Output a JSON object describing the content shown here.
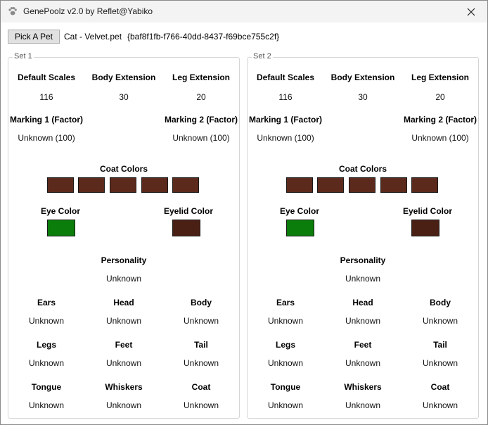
{
  "window": {
    "title": "GenePoolz v2.0 by Reflet@Yabiko"
  },
  "toolbar": {
    "pick_label": "Pick A Pet",
    "pet_name": "Cat - Velvet.pet",
    "pet_guid": "{baf8f1fb-f766-40dd-8437-f69bce755c2f}"
  },
  "labels": {
    "default_scales": "Default Scales",
    "body_extension": "Body Extension",
    "leg_extension": "Leg Extension",
    "marking1": "Marking 1 (Factor)",
    "marking2": "Marking 2 (Factor)",
    "coat_colors": "Coat Colors",
    "eye_color": "Eye Color",
    "eyelid_color": "Eyelid Color",
    "personality": "Personality",
    "ears": "Ears",
    "head": "Head",
    "body": "Body",
    "legs": "Legs",
    "feet": "Feet",
    "tail": "Tail",
    "tongue": "Tongue",
    "whiskers": "Whiskers",
    "coat": "Coat"
  },
  "sets": [
    {
      "title": "Set 1",
      "default_scales": "116",
      "body_extension": "30",
      "leg_extension": "20",
      "marking1": "Unknown (100)",
      "marking2": "Unknown (100)",
      "coat_colors": [
        "#5c2a1c",
        "#5c2a1c",
        "#5c2a1c",
        "#5c2a1c",
        "#5c2a1c"
      ],
      "eye_color": "#0a7d0a",
      "eyelid_color": "#4a2015",
      "personality": "Unknown",
      "ears": "Unknown",
      "head": "Unknown",
      "body": "Unknown",
      "legs": "Unknown",
      "feet": "Unknown",
      "tail": "Unknown",
      "tongue": "Unknown",
      "whiskers": "Unknown",
      "coat": "Unknown"
    },
    {
      "title": "Set 2",
      "default_scales": "116",
      "body_extension": "30",
      "leg_extension": "20",
      "marking1": "Unknown (100)",
      "marking2": "Unknown (100)",
      "coat_colors": [
        "#5c2a1c",
        "#5c2a1c",
        "#5c2a1c",
        "#5c2a1c",
        "#5c2a1c"
      ],
      "eye_color": "#0a7d0a",
      "eyelid_color": "#4a2015",
      "personality": "Unknown",
      "ears": "Unknown",
      "head": "Unknown",
      "body": "Unknown",
      "legs": "Unknown",
      "feet": "Unknown",
      "tail": "Unknown",
      "tongue": "Unknown",
      "whiskers": "Unknown",
      "coat": "Unknown"
    }
  ]
}
